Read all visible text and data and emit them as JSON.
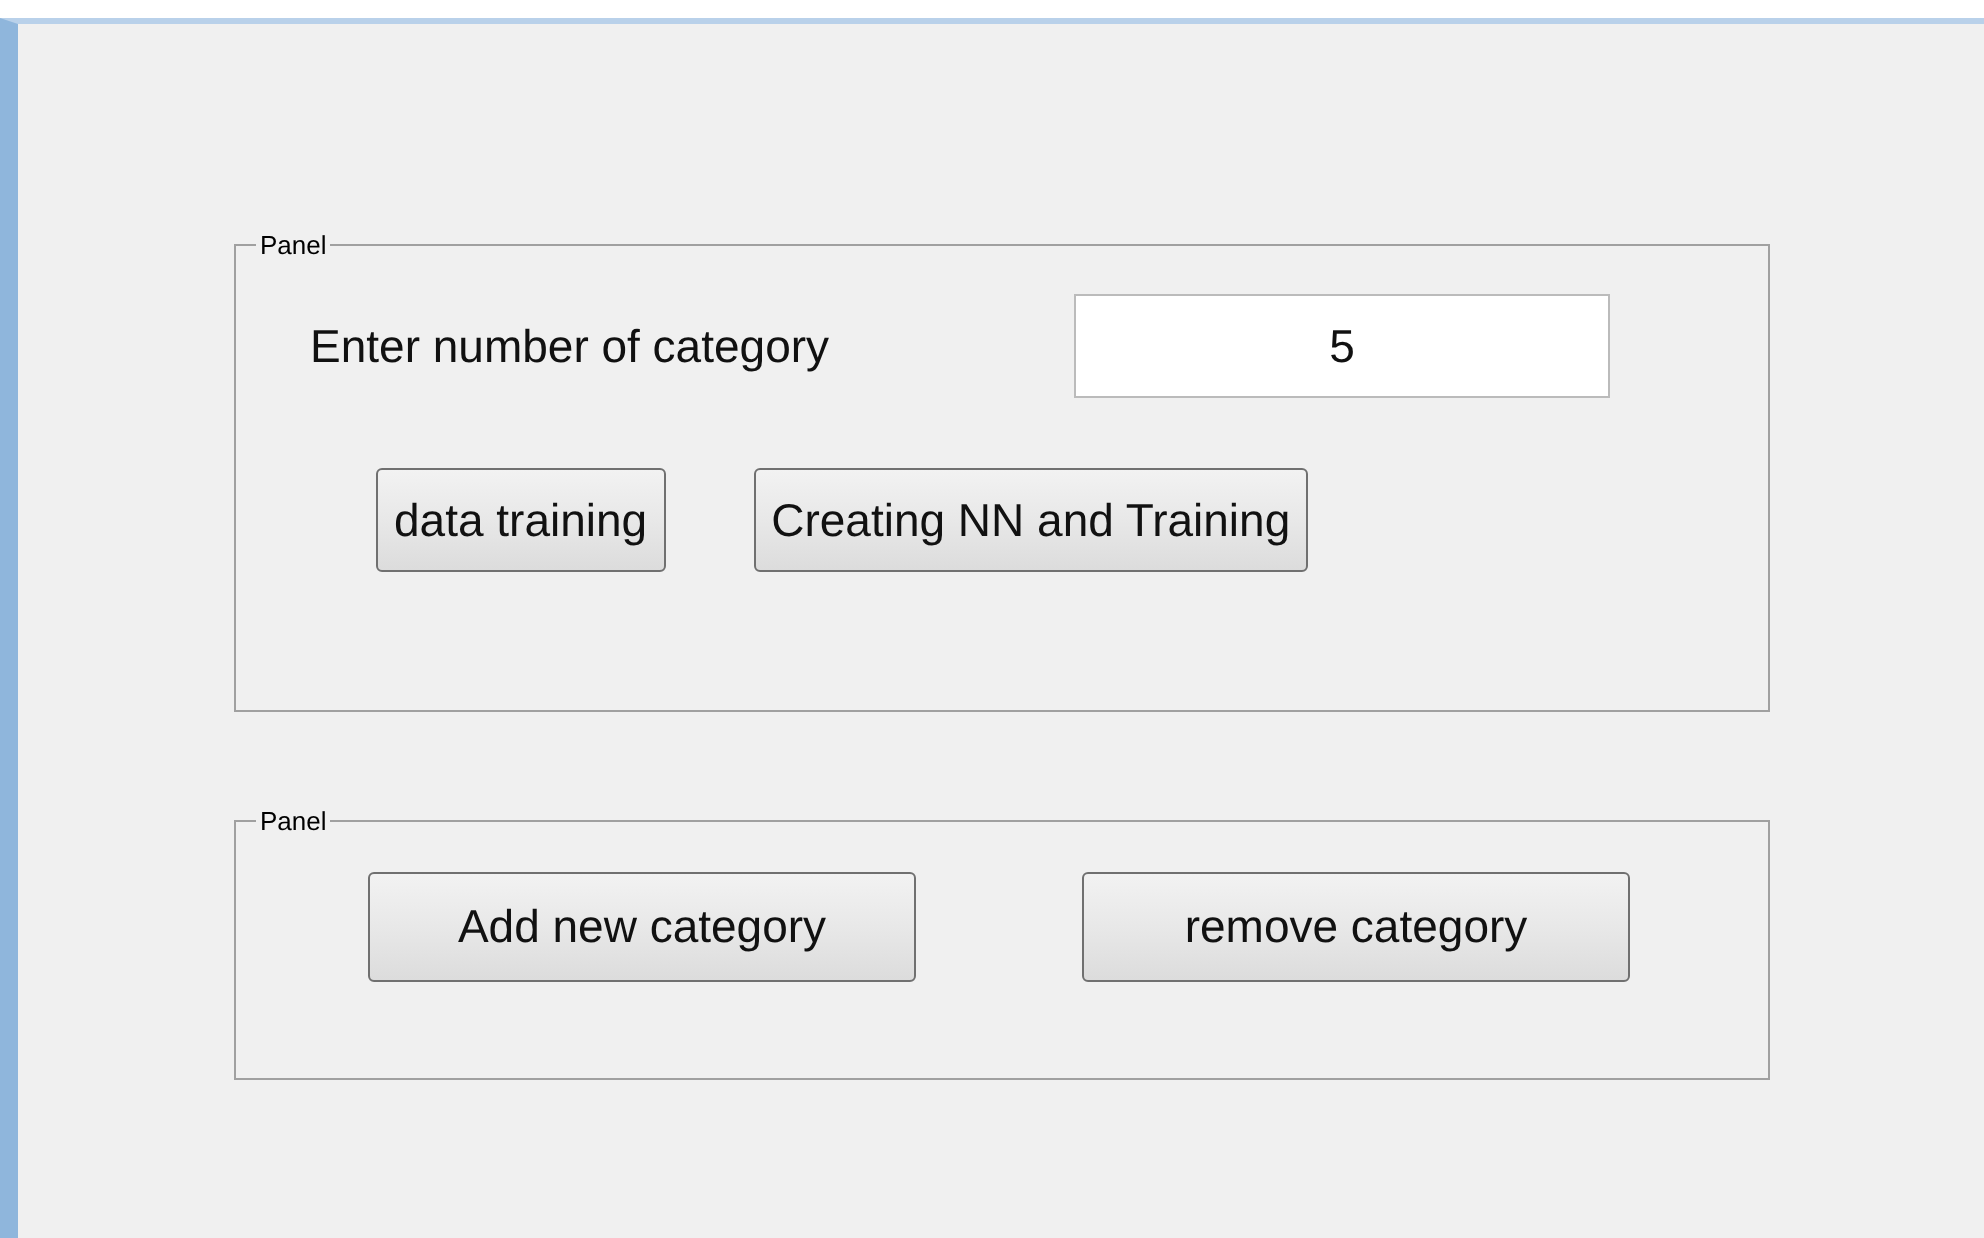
{
  "panels": [
    {
      "title": "Panel",
      "field": {
        "label": "Enter number of category",
        "value": "5"
      },
      "buttons": [
        "data training",
        "Creating NN and Training"
      ]
    },
    {
      "title": "Panel",
      "buttons": [
        "Add new category",
        "remove category"
      ]
    }
  ]
}
